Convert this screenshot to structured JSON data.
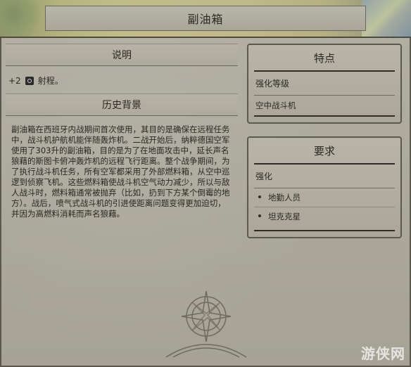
{
  "header": {
    "title": "副油箱"
  },
  "left": {
    "description_title": "说明",
    "bonus_value": "+2",
    "bonus_label": "射程。",
    "history_title": "历史背景",
    "history_text": "副油箱在西班牙内战期间首次使用，其目的是确保在远程任务中，战斗机护航机能伴随轰炸机。二战开始后，纳粹德国空军使用了303升的副油箱，目的是为了在地面攻击中，延长声名狼藉的斯图卡俯冲轰炸机的远程飞行距离。整个战争期间，为了执行战斗机任务，所有空军都采用了外部燃料箱，从空中巡逻到侦察飞机。这些燃料箱使战斗机空气动力减少，所以与敌人战斗时，燃料箱通常被抛弃（比如，扔到下方某个倒霉的地方）。战后，喷气式战斗机的引进使距离问题变得更加迫切，并因为高燃料消耗而声名狼藉。"
  },
  "right": {
    "features_title": "特点",
    "upgrade_level_label": "强化等级",
    "upgrade_level_value": "空中战斗机",
    "requirements_title": "要求",
    "requirements_subtitle": "强化",
    "requirements_items": [
      "地勤人员",
      "坦克克星"
    ]
  },
  "icons": {
    "bonus": "range-icon",
    "compass": "compass-rose-icon"
  },
  "watermark": "游侠网"
}
